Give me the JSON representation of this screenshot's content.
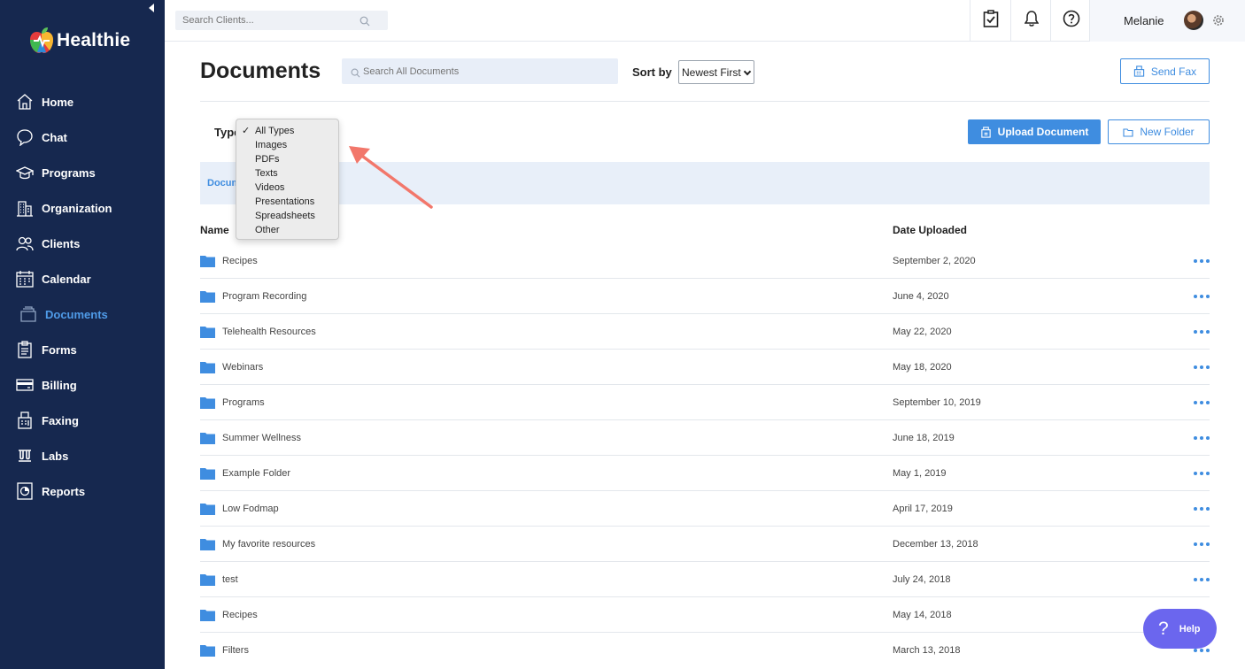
{
  "app": {
    "brand": "Healthie"
  },
  "sidebar": {
    "items": [
      {
        "label": "Home",
        "icon": "home-icon"
      },
      {
        "label": "Chat",
        "icon": "chat-icon"
      },
      {
        "label": "Programs",
        "icon": "programs-icon"
      },
      {
        "label": "Organization",
        "icon": "organization-icon"
      },
      {
        "label": "Clients",
        "icon": "clients-icon"
      },
      {
        "label": "Calendar",
        "icon": "calendar-icon"
      },
      {
        "label": "Documents",
        "icon": "documents-icon",
        "active": true
      },
      {
        "label": "Forms",
        "icon": "forms-icon"
      },
      {
        "label": "Billing",
        "icon": "billing-icon"
      },
      {
        "label": "Faxing",
        "icon": "faxing-icon"
      },
      {
        "label": "Labs",
        "icon": "labs-icon"
      },
      {
        "label": "Reports",
        "icon": "reports-icon"
      }
    ]
  },
  "topbar": {
    "client_search_placeholder": "Search Clients...",
    "user_name": "Melanie"
  },
  "main": {
    "title": "Documents",
    "doc_search_placeholder": "Search All Documents",
    "sort_label": "Sort by",
    "sort_value": "Newest First",
    "send_fax": "Send Fax",
    "type_label": "Type",
    "upload_document": "Upload Document",
    "new_folder": "New Folder",
    "breadcrumb": "Docum",
    "col_name": "Name",
    "col_date": "Date Uploaded"
  },
  "type_dropdown": {
    "selected": "All Types",
    "options": [
      "All Types",
      "Images",
      "PDFs",
      "Texts",
      "Videos",
      "Presentations",
      "Spreadsheets",
      "Other"
    ]
  },
  "rows": [
    {
      "name": "Recipes",
      "date": "September 2, 2020"
    },
    {
      "name": "Program Recording",
      "date": "June 4, 2020"
    },
    {
      "name": "Telehealth Resources",
      "date": "May 22, 2020"
    },
    {
      "name": "Webinars",
      "date": "May 18, 2020"
    },
    {
      "name": "Programs",
      "date": "September 10, 2019"
    },
    {
      "name": "Summer Wellness",
      "date": "June 18, 2019"
    },
    {
      "name": "Example Folder",
      "date": "May 1, 2019"
    },
    {
      "name": "Low Fodmap",
      "date": "April 17, 2019"
    },
    {
      "name": "My favorite resources",
      "date": "December 13, 2018"
    },
    {
      "name": "test",
      "date": "July 24, 2018"
    },
    {
      "name": "Recipes",
      "date": "May 14, 2018"
    },
    {
      "name": "Filters",
      "date": "March 13, 2018"
    }
  ],
  "help": {
    "label": "Help"
  },
  "colors": {
    "sidebar_bg": "#16284f",
    "accent": "#3f8de0",
    "help_bg": "#6b66ee",
    "annotation_arrow": "#f2776b"
  }
}
